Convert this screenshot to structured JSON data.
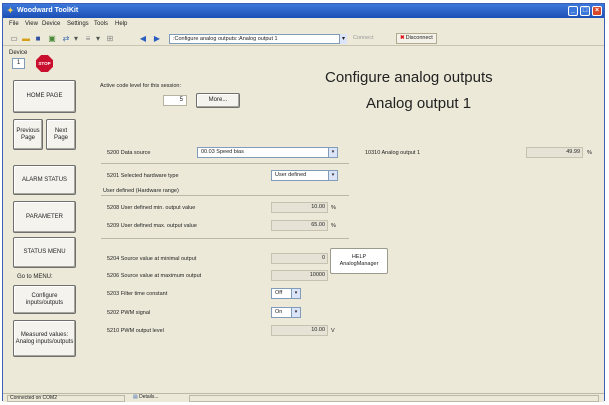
{
  "window": {
    "title": "Woodward ToolKit",
    "controls": {
      "minimize": "_",
      "maximize": "□",
      "close": "×"
    }
  },
  "menu": [
    "File",
    "View",
    "Device",
    "Settings",
    "Tools",
    "Help"
  ],
  "toolbar": {
    "nav_path": ":Configure analog outputs::Analog output 1",
    "disabled_label": "Connect",
    "disconnect_label": "Disconnect"
  },
  "device": {
    "label": "Device",
    "number": "1",
    "stop_label": "STOP"
  },
  "nav": {
    "home": "HOME PAGE",
    "previous": "Previous Page",
    "next": "Next Page",
    "alarm": "ALARM STATUS",
    "parameter": "PARAMETER",
    "status": "STATUS MENU",
    "goto": "Go to MENU:",
    "configure": "Configure inputs/outputs",
    "measured": "Measured values: Analog inputs/outputs"
  },
  "code_level": {
    "label": "Active code level for this session:",
    "value": "5",
    "more_label": "More..."
  },
  "header": {
    "line1": "Configure analog outputs",
    "line2": "Analog output 1"
  },
  "params": {
    "data_source": {
      "label": "5200 Data source",
      "value": "00.03 Speed bias"
    },
    "hardware_type": {
      "label": "5201 Selected hardware type",
      "value": "User defined"
    },
    "user_defined_header": "User defined (Hardware range)",
    "min_output": {
      "label": "5208 User defined min. output value",
      "value": "10.00",
      "unit": "%"
    },
    "max_output": {
      "label": "5209 User defined max. output value",
      "value": "65.00",
      "unit": "%"
    },
    "source_min": {
      "label": "5204 Source value at minimal output",
      "value": "0"
    },
    "source_max": {
      "label": "5206 Source value at maximum output",
      "value": "10000"
    },
    "filter": {
      "label": "5203 Filter time constant",
      "value": "Off"
    },
    "pwm_signal": {
      "label": "5202 PWM signal",
      "value": "On"
    },
    "pwm_level": {
      "label": "5210 PWM output level",
      "value": "10.00",
      "unit": "V"
    },
    "analog_output": {
      "label": "10310 Analog output 1",
      "value": "49.99",
      "unit": "%"
    }
  },
  "help": {
    "line1": "HELP",
    "line2": "AnalogManager"
  },
  "statusbar": {
    "connection": "Connected on COM2",
    "details": "Details..."
  }
}
